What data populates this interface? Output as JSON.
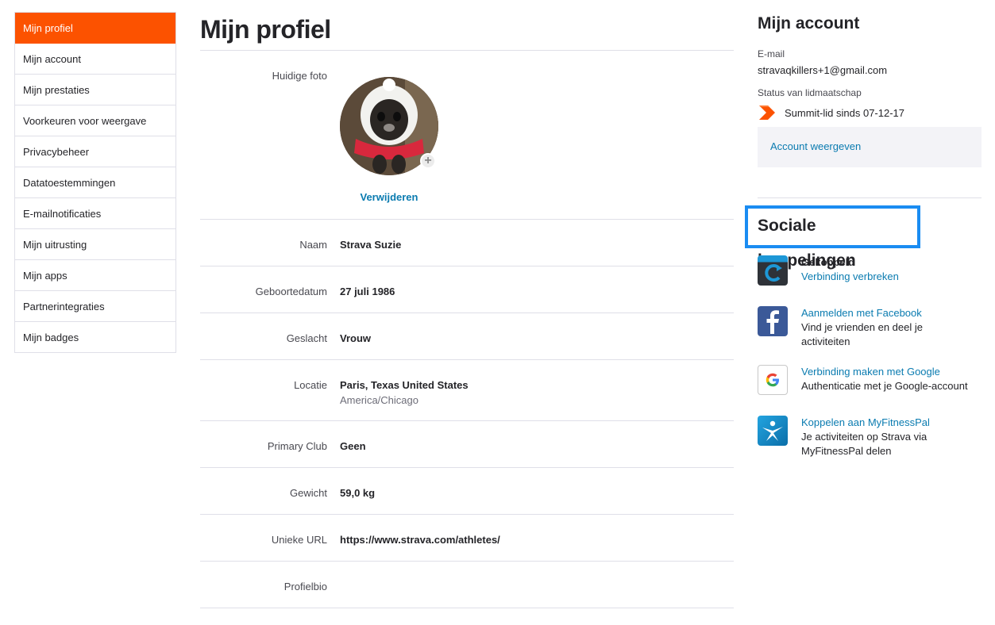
{
  "sidebar": {
    "items": [
      {
        "label": "Mijn profiel",
        "active": true
      },
      {
        "label": "Mijn account"
      },
      {
        "label": "Mijn prestaties"
      },
      {
        "label": "Voorkeuren voor weergave"
      },
      {
        "label": "Privacybeheer"
      },
      {
        "label": "Datatoestemmingen"
      },
      {
        "label": "E-mailnotificaties"
      },
      {
        "label": "Mijn uitrusting"
      },
      {
        "label": "Mijn apps"
      },
      {
        "label": "Partnerintegraties"
      },
      {
        "label": "Mijn badges"
      }
    ]
  },
  "profile": {
    "title": "Mijn profiel",
    "photo_label": "Huidige foto",
    "remove_label": "Verwijderen",
    "fields": {
      "name": {
        "label": "Naam",
        "value": "Strava Suzie"
      },
      "birthdate": {
        "label": "Geboortedatum",
        "value": "27 juli 1986"
      },
      "gender": {
        "label": "Geslacht",
        "value": "Vrouw"
      },
      "location": {
        "label": "Locatie",
        "value": "Paris, Texas United States",
        "sub": "America/Chicago"
      },
      "club": {
        "label": "Primary Club",
        "value": "Geen"
      },
      "weight": {
        "label": "Gewicht",
        "value": "59,0 kg"
      },
      "url": {
        "label": "Unieke URL",
        "value": "https://www.strava.com/athletes/"
      },
      "bio": {
        "label": "Profielbio",
        "value": ""
      }
    }
  },
  "account": {
    "title": "Mijn account",
    "email_label": "E-mail",
    "email": "stravaqkillers+1@gmail.com",
    "status_label": "Status van lidmaatschap",
    "status": "Summit-lid sinds 07-12-17",
    "view_link": "Account weergeven"
  },
  "social": {
    "title": "Sociale koppelingen",
    "items": [
      {
        "icon": "garmin-icon",
        "bold": "Gekoppeld",
        "link": "Verbinding verbreken"
      },
      {
        "icon": "facebook-icon",
        "link": "Aanmelden met Facebook",
        "text": "Vind je vrienden en deel je activiteiten"
      },
      {
        "icon": "google-icon",
        "link": "Verbinding maken met Google",
        "text": "Authenticatie met je Google-account"
      },
      {
        "icon": "myfitnesspal-icon",
        "link": "Koppelen aan MyFitnessPal",
        "text": "Je activiteiten op Strava via MyFitnessPal delen"
      }
    ]
  },
  "colors": {
    "brand": "#fc5200",
    "link": "#0a7bb0",
    "highlight": "#1a8cf2"
  }
}
